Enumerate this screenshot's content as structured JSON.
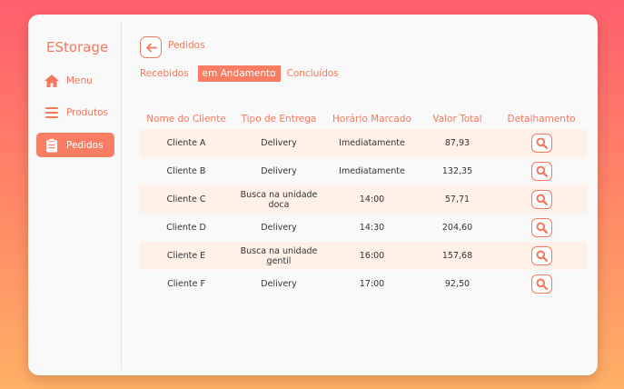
{
  "brand": "EStorage",
  "sidebar": {
    "items": [
      {
        "label": "Menu",
        "icon": "home-icon"
      },
      {
        "label": "Produtos",
        "icon": "list-icon"
      },
      {
        "label": "Pedidos",
        "icon": "clipboard-icon",
        "active": true
      }
    ]
  },
  "breadcrumb": "Pedidos",
  "tabs": [
    {
      "label": "Recebidos"
    },
    {
      "label": "em Andamento",
      "active": true
    },
    {
      "label": "Concluídos"
    }
  ],
  "table": {
    "headers": [
      "Nome do Cliente",
      "Tipo de Entrega",
      "Horário Marcado",
      "Valor Total",
      "Detalhamento"
    ],
    "rows": [
      {
        "cliente": "Cliente A",
        "entrega": "Delivery",
        "horario": "Imediatamente",
        "valor": "87,93"
      },
      {
        "cliente": "Cliente B",
        "entrega": "Delivery",
        "horario": "Imediatamente",
        "valor": "132,35"
      },
      {
        "cliente": "Cliente C",
        "entrega": "Busca na unidade doca",
        "horario": "14:00",
        "valor": "57,71"
      },
      {
        "cliente": "Cliente D",
        "entrega": "Delivery",
        "horario": "14:30",
        "valor": "204,60"
      },
      {
        "cliente": "Cliente E",
        "entrega": "Busca na unidade gentil",
        "horario": "16:00",
        "valor": "157,68"
      },
      {
        "cliente": "Cliente F",
        "entrega": "Delivery",
        "horario": "17:00",
        "valor": "92,50"
      }
    ]
  },
  "colors": {
    "accent": "#f97d62",
    "row_highlight": "#fff0e8"
  }
}
